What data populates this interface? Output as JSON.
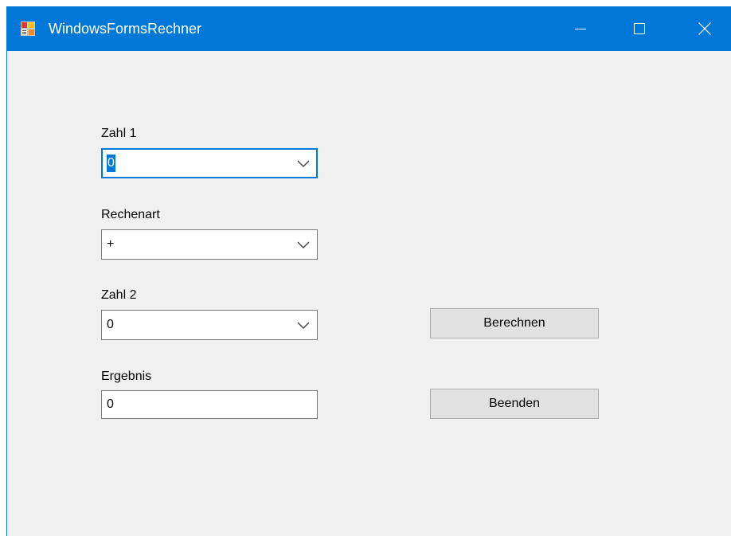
{
  "window": {
    "title": "WindowsFormsRechner",
    "controls": [
      "minimize-icon",
      "maximize-icon",
      "close-icon"
    ]
  },
  "form": {
    "zahl1": {
      "label": "Zahl 1",
      "value": "0"
    },
    "rechenart": {
      "label": "Rechenart",
      "value": "+"
    },
    "zahl2": {
      "label": "Zahl 2",
      "value": "0"
    },
    "ergebnis": {
      "label": "Ergebnis",
      "value": "0"
    }
  },
  "buttons": {
    "berechnen": "Berechnen",
    "beenden": "Beenden"
  },
  "colors": {
    "titlebar": "#0078d7",
    "window_bg": "#f0f0f0",
    "button_bg": "#e1e1e1",
    "focus_border": "#0078d7"
  }
}
